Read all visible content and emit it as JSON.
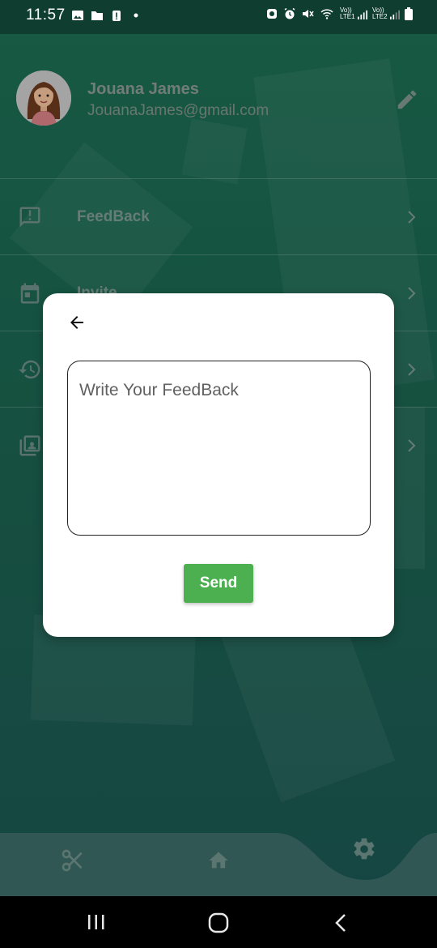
{
  "status_bar": {
    "time": "11:57",
    "left_icons": [
      "image-icon",
      "folder-icon",
      "battery-alert-icon",
      "dot-icon"
    ],
    "right_icons": [
      "notification-icon",
      "alarm-icon",
      "mute-icon",
      "wifi-icon",
      "signal-lte1-icon",
      "signal-lte2-icon",
      "battery-icon"
    ],
    "lte1_label": "Vo)) LTE1",
    "lte2_label": "Vo)) LTE2"
  },
  "profile": {
    "name": "Jouana James",
    "email": "JouanaJames@gmail.com",
    "edit_icon": "pencil-icon"
  },
  "menu": {
    "items": [
      {
        "label": "FeedBack",
        "icon": "feedback-icon"
      },
      {
        "label": "Invite",
        "icon": "calendar-icon"
      },
      {
        "label": "",
        "icon": "history-icon"
      },
      {
        "label": "",
        "icon": "gallery-icon"
      }
    ]
  },
  "dialog": {
    "back_icon": "arrow-back-icon",
    "feedback_placeholder": "Write Your FeedBack",
    "feedback_value": "",
    "send_label": "Send"
  },
  "bottom_nav": {
    "items": [
      {
        "icon": "scissors-icon"
      },
      {
        "icon": "home-icon"
      },
      {
        "icon": "settings-icon",
        "active": true
      }
    ]
  },
  "system_nav": {
    "icons": [
      "recent-apps-icon",
      "home-circle-icon",
      "back-chevron-icon"
    ]
  },
  "colors": {
    "background": "#1d6d52",
    "accent": "#4caf50",
    "dialog": "#ffffff",
    "bottom_bar": "#3b6b66"
  }
}
